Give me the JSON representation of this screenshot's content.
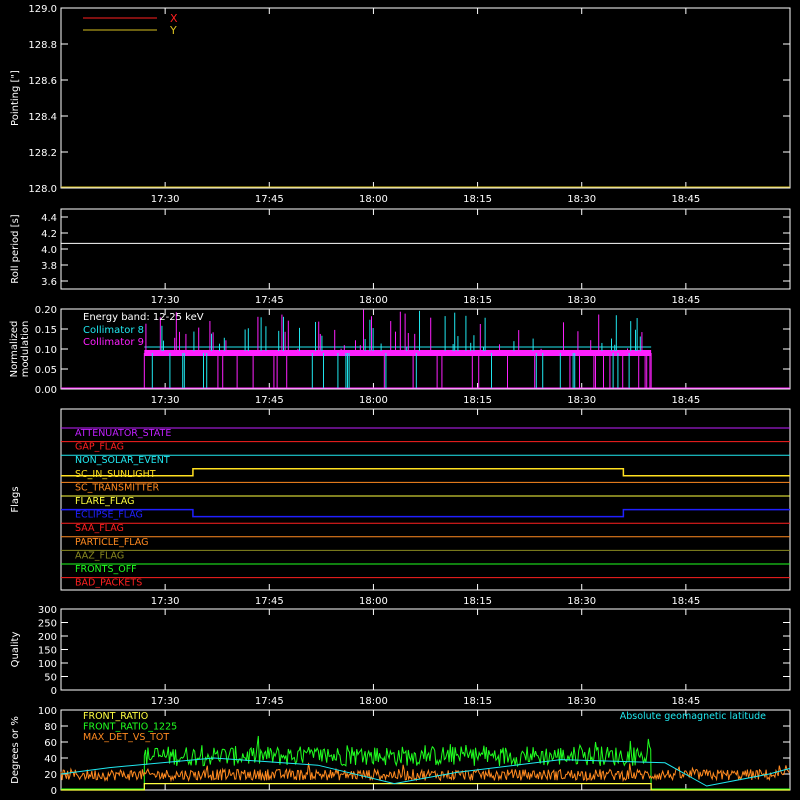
{
  "colors": {
    "background": "#000000",
    "axes": "#ffffff",
    "x_series": "#ff2020",
    "y_series": "#d8c020",
    "cyan": "#20e8f0",
    "magenta": "#ff20ff",
    "green": "#20ff20",
    "orange": "#ff8a20",
    "blue": "#2020ff"
  },
  "time_ticks": [
    "17:30",
    "17:45",
    "18:00",
    "18:15",
    "18:30",
    "18:45"
  ],
  "chart_data": [
    {
      "id": "pointing",
      "type": "line",
      "ylabel": "Pointing [\"]",
      "ylim": [
        128.0,
        129.0
      ],
      "yticks": [
        "129.0",
        "128.8",
        "128.6",
        "128.4",
        "128.2",
        "128.0"
      ],
      "legend": [
        {
          "name": "X",
          "color": "#ff2020"
        },
        {
          "name": "Y",
          "color": "#d8c020"
        }
      ],
      "series": [
        {
          "name": "X",
          "values": []
        },
        {
          "name": "Y",
          "values": []
        }
      ]
    },
    {
      "id": "roll",
      "type": "line",
      "ylabel": "Roll period [s]",
      "ylim": [
        3.5,
        4.5
      ],
      "yticks": [
        "4.4",
        "4.2",
        "4.0",
        "3.8",
        "3.6"
      ],
      "series": [
        {
          "name": "Roll period",
          "x": [
            "17:15",
            "19:00"
          ],
          "values": [
            4.07,
            4.07
          ]
        }
      ]
    },
    {
      "id": "modulation",
      "type": "line",
      "ylabel": "Normalized modulation",
      "ylabel_lines": [
        "Normalized",
        "modulation"
      ],
      "ylim": [
        0,
        0.2
      ],
      "yticks": [
        "0.20",
        "0.15",
        "0.10",
        "0.05",
        "0.00"
      ],
      "annotation": "Energy band: 12-25 keV",
      "legend": [
        {
          "name": "Collimator 8",
          "color": "#20e8f0"
        },
        {
          "name": "Collimator 9",
          "color": "#ff20ff"
        }
      ],
      "active_range": [
        "17:27",
        "18:40"
      ],
      "series": [
        {
          "name": "Collimator 8",
          "baseline": 0.095
        },
        {
          "name": "Collimator 9",
          "baseline": 0.09
        }
      ]
    },
    {
      "id": "flags",
      "type": "line",
      "ylabel": "Flags",
      "flags": [
        {
          "name": "ATTENUATOR_STATE",
          "color": "#c020ff",
          "state": "off"
        },
        {
          "name": "GAP_FLAG",
          "color": "#ff2020",
          "state": "off"
        },
        {
          "name": "NON_SOLAR_EVENT",
          "color": "#20e8f0",
          "state": "off"
        },
        {
          "name": "SC_IN_SUNLIGHT",
          "color": "#ffe020",
          "state": "on",
          "on_range": [
            "17:34",
            "18:36"
          ]
        },
        {
          "name": "SC_TRANSMITTER",
          "color": "#ff8a20",
          "state": "off"
        },
        {
          "name": "FLARE_FLAG",
          "color": "#ffff40",
          "state": "off"
        },
        {
          "name": "ECLIPSE_FLAG",
          "color": "#2020ff",
          "state": "on",
          "on_range": [
            "17:15",
            "17:34"
          ],
          "on_range2": [
            "18:36",
            "19:00"
          ]
        },
        {
          "name": "SAA_FLAG",
          "color": "#ff2020",
          "state": "off"
        },
        {
          "name": "PARTICLE_FLAG",
          "color": "#ff8a20",
          "state": "off"
        },
        {
          "name": "AAZ_FLAG",
          "color": "#8a8a20",
          "state": "off"
        },
        {
          "name": "FRONTS_OFF",
          "color": "#20ff20",
          "state": "off"
        },
        {
          "name": "BAD_PACKETS",
          "color": "#ff2020",
          "state": "off"
        }
      ]
    },
    {
      "id": "quality",
      "type": "line",
      "ylabel": "Quality",
      "ylim": [
        0,
        300
      ],
      "yticks": [
        "300",
        "250",
        "200",
        "150",
        "100",
        "50",
        "0"
      ],
      "series": []
    },
    {
      "id": "geomag",
      "type": "line",
      "ylabel": "Degrees or %",
      "ylim": [
        0,
        100
      ],
      "yticks": [
        "100",
        "80",
        "60",
        "40",
        "20",
        "0"
      ],
      "legend": [
        {
          "name": "FRONT_RATIO",
          "color": "#ffff40"
        },
        {
          "name": "FRONT_RATIO_1225",
          "color": "#20ff20"
        },
        {
          "name": "MAX_DET_VS_TOT",
          "color": "#ff8a20"
        }
      ],
      "right_legend": {
        "name": "Absolute geomagnetic latitude",
        "color": "#20e8f0"
      },
      "series": [
        {
          "name": "FRONT_RATIO",
          "x": [
            "17:15",
            "17:27",
            "17:27",
            "18:40",
            "18:40",
            "19:00"
          ],
          "values": [
            0,
            0,
            8,
            8,
            0,
            0
          ]
        },
        {
          "name": "FRONT_RATIO_1225",
          "active_range": [
            "17:27",
            "18:40"
          ],
          "mean": 48
        },
        {
          "name": "MAX_DET_VS_TOT",
          "mean": 20
        },
        {
          "name": "Absolute geomagnetic latitude",
          "x": [
            "17:15",
            "17:22",
            "17:37",
            "17:52",
            "18:03",
            "18:12",
            "18:27",
            "18:42",
            "18:48",
            "18:57",
            "19:00"
          ],
          "values": [
            20,
            28,
            40,
            31,
            8,
            22,
            38,
            34,
            5,
            20,
            27
          ]
        }
      ]
    }
  ]
}
